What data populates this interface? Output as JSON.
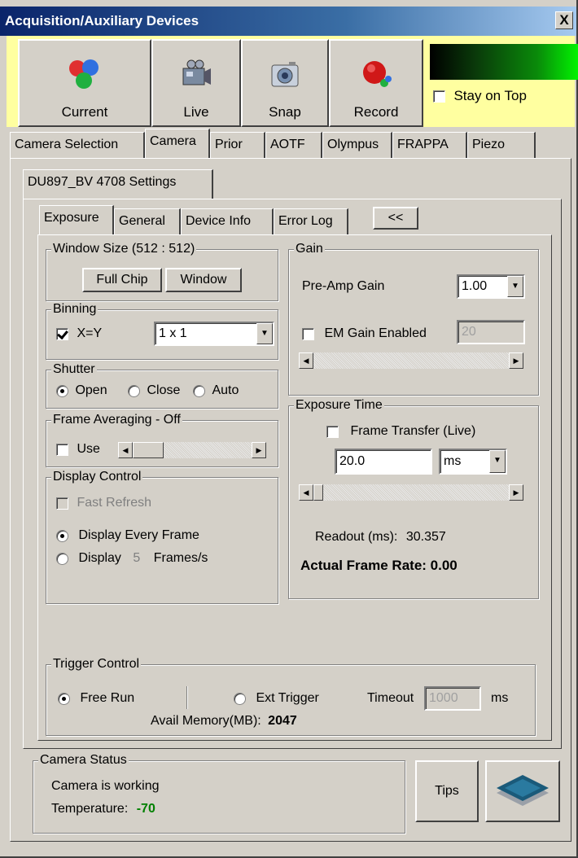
{
  "window": {
    "title": "Acquisition/Auxiliary Devices",
    "close_glyph": "X"
  },
  "toolbar": {
    "current_label": "Current",
    "live_label": "Live",
    "snap_label": "Snap",
    "record_label": "Record",
    "stay_on_top_label": "Stay on Top",
    "stay_on_top_checked": false
  },
  "main_tabs": [
    "Camera Selection",
    "Camera",
    "Prior",
    "AOTF",
    "Olympus",
    "FRAPPA",
    "Piezo"
  ],
  "settings_tab": "DU897_BV 4708 Settings",
  "sub_tabs": [
    "Exposure",
    "General",
    "Device Info",
    "Error Log"
  ],
  "collapse_label": "<<",
  "window_size": {
    "title": "Window Size (512 : 512)",
    "full_chip": "Full Chip",
    "window_btn": "Window"
  },
  "binning": {
    "title": "Binning",
    "xy_label": "X=Y",
    "xy_checked": true,
    "value": "1 x 1"
  },
  "shutter": {
    "title": "Shutter",
    "options": [
      "Open",
      "Close",
      "Auto"
    ],
    "selected": "Open"
  },
  "frame_averaging": {
    "title": "Frame Averaging - Off",
    "use_label": "Use"
  },
  "display_control": {
    "title": "Display Control",
    "fast_refresh": "Fast Refresh",
    "every_frame": "Display Every Frame",
    "display_label": "Display",
    "display_value": "5",
    "frames_unit": "Frames/s"
  },
  "gain": {
    "title": "Gain",
    "preamp_label": "Pre-Amp Gain",
    "preamp_value": "1.00",
    "em_label": "EM Gain Enabled",
    "em_value": "20"
  },
  "exposure_time": {
    "title": "Exposure Time",
    "frame_transfer": "Frame Transfer (Live)",
    "value": "20.0",
    "unit": "ms",
    "readout_label": "Readout (ms):",
    "readout_value": "30.357",
    "frame_rate": "Actual Frame Rate: 0.00"
  },
  "trigger": {
    "title": "Trigger Control",
    "free_run": "Free Run",
    "ext_trigger": "Ext Trigger",
    "timeout_label": "Timeout",
    "timeout_value": "1000",
    "timeout_unit": "ms",
    "memory_label": "Avail Memory(MB):",
    "memory_value": "2047"
  },
  "camera_status": {
    "title": "Camera Status",
    "status": "Camera is working",
    "temp_label": "Temperature:",
    "temp_value": "-70",
    "temp_color": "#008000"
  },
  "tips_label": "Tips",
  "icons": [
    "current-icon",
    "live-camera-icon",
    "snap-camera-icon",
    "record-icon",
    "layers-logo-icon"
  ]
}
